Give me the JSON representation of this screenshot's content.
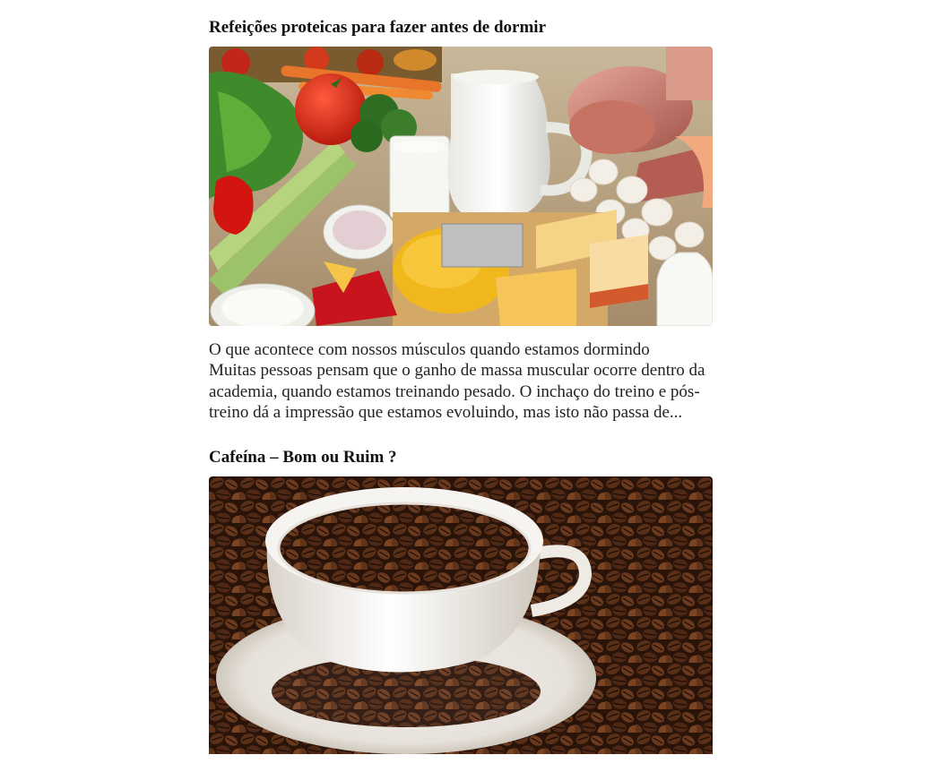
{
  "posts": [
    {
      "title": "Refeições proteicas para fazer antes de dormir",
      "excerpt_lines": [
        "O que acontece com nossos músculos quando estamos dormindo",
        "Muitas pessoas pensam que o ganho de massa muscular ocorre dentro da academia, quando estamos treinando pesado. O inchaço do treino e pós-treino dá a impressão que estamos evoluindo, mas isto não passa de..."
      ],
      "image_subject": "protein-foods-photo"
    },
    {
      "title": "Cafeína – Bom ou Ruim ?",
      "image_subject": "coffee-beans-cup-photo"
    }
  ],
  "colors": {
    "text": "#111111",
    "background": "#ffffff",
    "coffee": "#3a1f12"
  }
}
